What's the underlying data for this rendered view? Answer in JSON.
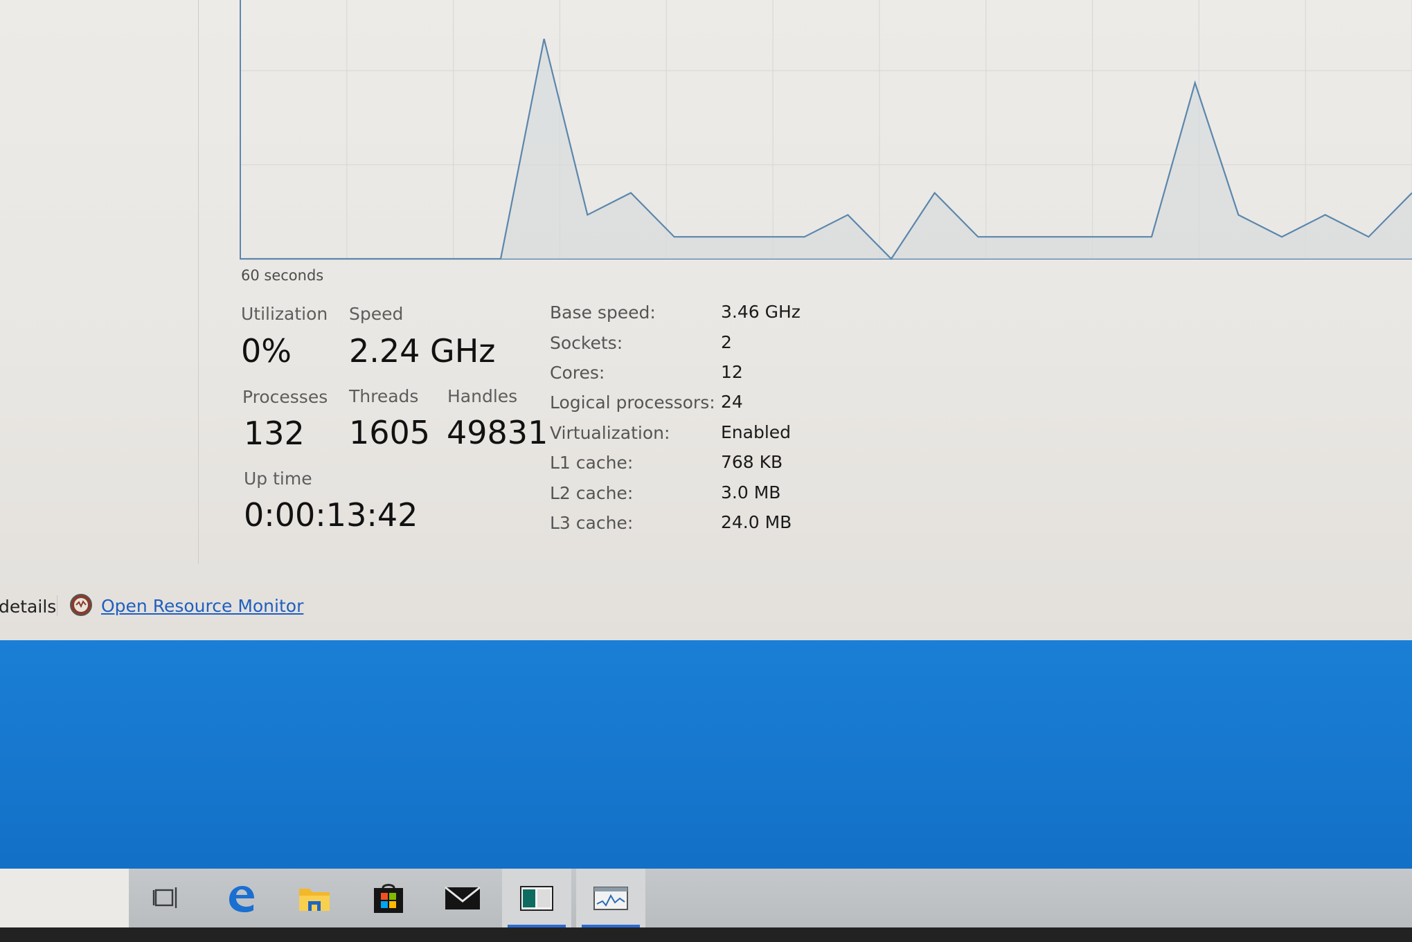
{
  "performance": {
    "graph": {
      "x_axis_label": "60 seconds",
      "cpu_percent_samples": [
        0,
        0,
        0,
        0,
        0,
        0,
        0,
        10,
        2,
        3,
        1,
        1,
        1,
        1,
        2,
        0,
        3,
        1,
        1,
        1,
        1,
        1,
        8,
        2,
        1,
        2,
        1,
        3
      ],
      "line_color": "#5b86ad",
      "fill_color": "#d7dbdd"
    },
    "stats": {
      "utilization_label": "Utilization",
      "utilization_value": "0%",
      "speed_label": "Speed",
      "speed_value": "2.24 GHz",
      "processes_label": "Processes",
      "processes_value": "132",
      "threads_label": "Threads",
      "threads_value": "1605",
      "handles_label": "Handles",
      "handles_value": "49831",
      "uptime_label": "Up time",
      "uptime_value": "0:00:13:42"
    },
    "specs": [
      {
        "label": "Base speed:",
        "value": "3.46 GHz"
      },
      {
        "label": "Sockets:",
        "value": "2"
      },
      {
        "label": "Cores:",
        "value": "12"
      },
      {
        "label": "Logical processors:",
        "value": "24"
      },
      {
        "label": "Virtualization:",
        "value": "Enabled"
      },
      {
        "label": "L1 cache:",
        "value": "768 KB"
      },
      {
        "label": "L2 cache:",
        "value": "3.0 MB"
      },
      {
        "label": "L3 cache:",
        "value": "24.0 MB"
      }
    ]
  },
  "footer": {
    "details_label": "details",
    "resource_monitor_link": "Open Resource Monitor"
  },
  "taskbar": {
    "apps": [
      {
        "name": "task-view-icon",
        "active": false
      },
      {
        "name": "edge-icon",
        "active": false
      },
      {
        "name": "file-explorer-icon",
        "active": false
      },
      {
        "name": "store-icon",
        "active": false
      },
      {
        "name": "mail-icon",
        "active": false
      },
      {
        "name": "app-window-icon",
        "active": true
      },
      {
        "name": "task-manager-icon",
        "active": true
      }
    ]
  },
  "colors": {
    "desktop_blue": "#1879d0",
    "link_blue": "#1f5fbf",
    "active_underline": "#2d6bd0"
  }
}
